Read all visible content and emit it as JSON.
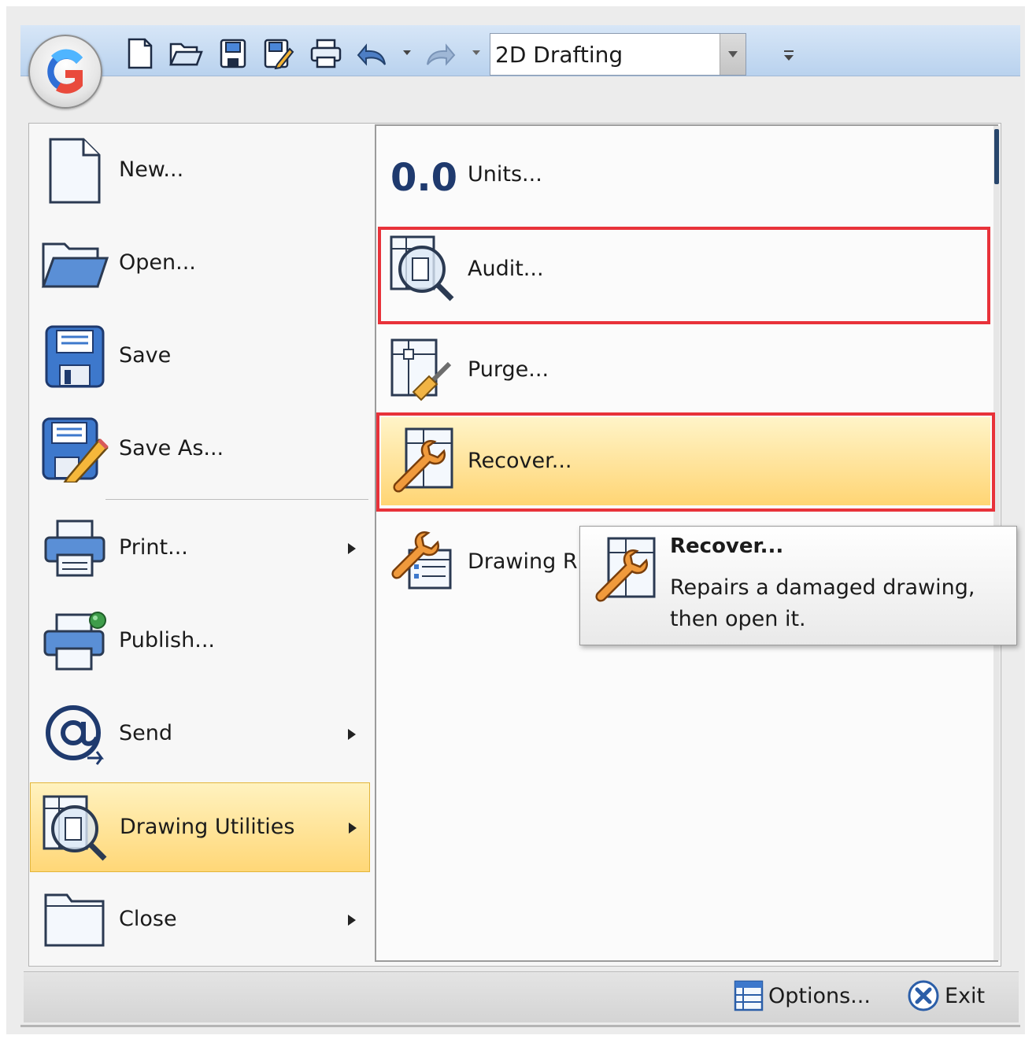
{
  "quick_access": {
    "workspace": "2D Drafting",
    "icons": [
      "new-icon",
      "open-icon",
      "save-icon",
      "save-as-icon",
      "print-icon",
      "undo-icon",
      "redo-icon"
    ]
  },
  "left_menu": {
    "items": [
      {
        "label": "New...",
        "icon": "new-document-icon",
        "submenu": false
      },
      {
        "label": "Open...",
        "icon": "open-folder-icon",
        "submenu": false
      },
      {
        "label": "Save",
        "icon": "save-floppy-icon",
        "submenu": false
      },
      {
        "label": "Save As...",
        "icon": "save-as-pencil-icon",
        "submenu": false
      },
      {
        "label": "Print...",
        "icon": "printer-icon",
        "submenu": true
      },
      {
        "label": "Publish...",
        "icon": "publish-printer-icon",
        "submenu": false
      },
      {
        "label": "Send",
        "icon": "at-send-icon",
        "submenu": true
      },
      {
        "label": "Drawing Utilities",
        "icon": "drawing-utilities-icon",
        "submenu": true,
        "active": true
      },
      {
        "label": "Close",
        "icon": "close-folder-icon",
        "submenu": true
      }
    ]
  },
  "right_menu": {
    "units_value": "0.0",
    "items": [
      {
        "label": "Units...",
        "icon": "units-icon"
      },
      {
        "label": "Audit...",
        "icon": "audit-magnifier-icon",
        "outlined": true
      },
      {
        "label": "Purge...",
        "icon": "purge-broom-icon"
      },
      {
        "label": "Recover...",
        "icon": "recover-wrench-icon",
        "outlined": true,
        "hovered": true
      },
      {
        "label": "Drawing R",
        "icon": "drawing-recovery-icon"
      }
    ]
  },
  "tooltip": {
    "title": "Recover...",
    "description": "Repairs a damaged drawing, then open it."
  },
  "bottom_bar": {
    "options_label": "Options...",
    "exit_label": "Exit"
  },
  "colors": {
    "highlight_outline": "#e8323a",
    "active_gradient_top": "#fff2bf",
    "active_gradient_bottom": "#ffd777",
    "toolbar_top": "#d7e6f7",
    "toolbar_bottom": "#b9d2ee"
  }
}
